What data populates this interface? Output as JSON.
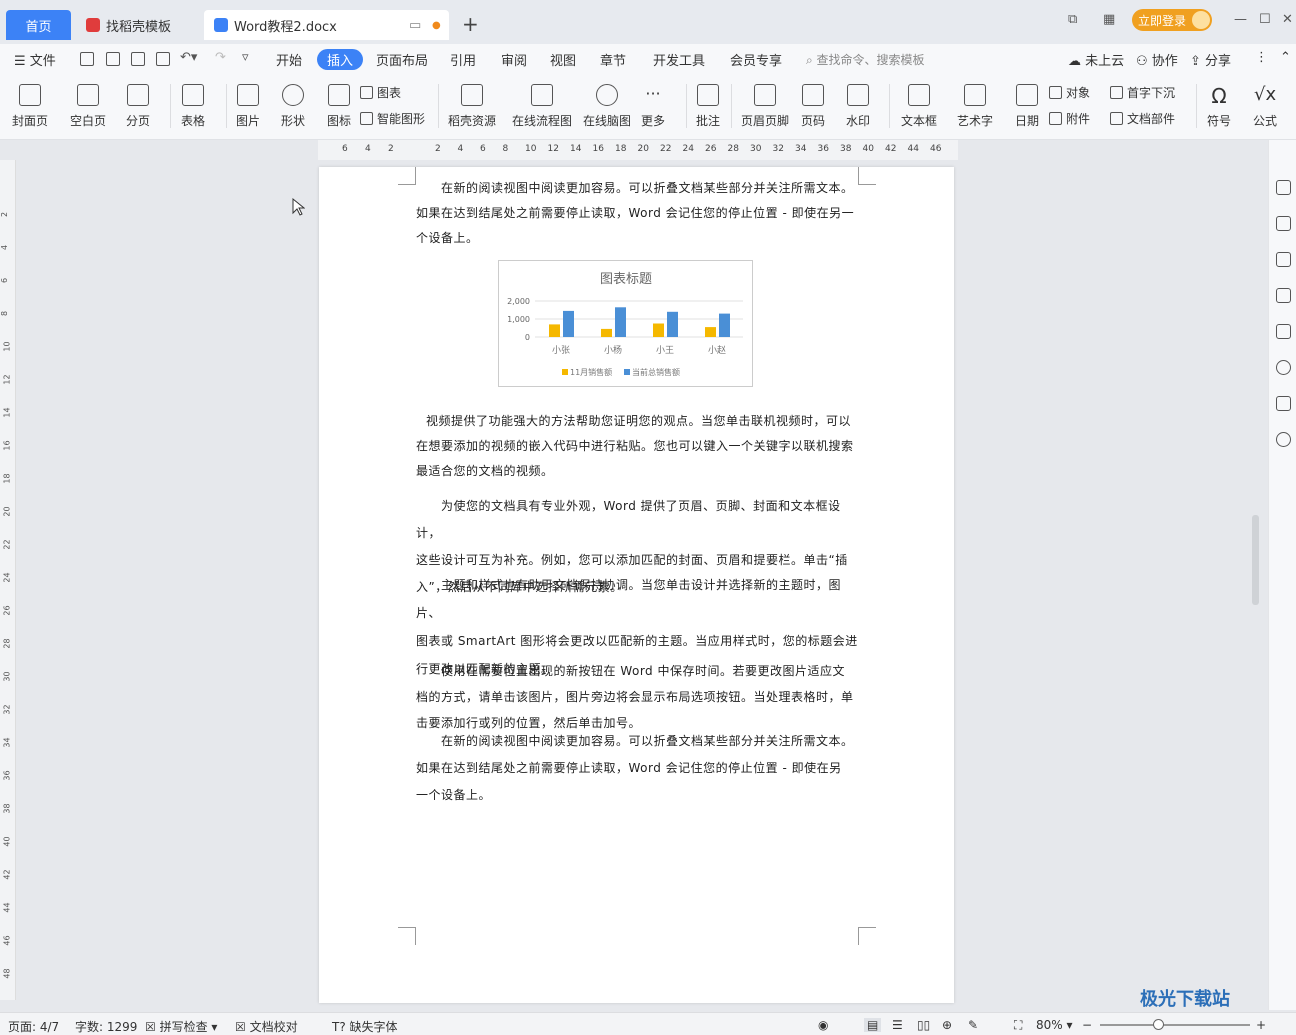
{
  "tabs": {
    "home": "首页",
    "template": "找稻壳模板",
    "doc": "Word教程2.docx"
  },
  "header": {
    "login": "立即登录"
  },
  "menu": {
    "file": "文件",
    "items": [
      "开始",
      "插入",
      "页面布局",
      "引用",
      "审阅",
      "视图",
      "章节",
      "开发工具",
      "会员专享"
    ],
    "active": "插入",
    "search": "查找命令、搜索模板",
    "cloud": "未上云",
    "collab": "协作",
    "share": "分享"
  },
  "ribbon": {
    "cover": "封面页",
    "blank": "空白页",
    "pagebreak": "分页",
    "table": "表格",
    "picture": "图片",
    "shape": "形状",
    "icon": "图标",
    "chart": "图表",
    "smartart": "智能图形",
    "docer": "稻壳资源",
    "flow": "在线流程图",
    "mind": "在线脑图",
    "more": "更多",
    "comment": "批注",
    "headerfooter": "页眉页脚",
    "pagenum": "页码",
    "watermark": "水印",
    "textbox": "文本框",
    "wordart": "艺术字",
    "date": "日期",
    "object": "对象",
    "attach": "附件",
    "dropcap": "首字下沉",
    "docpart": "文档部件",
    "symbol": "符号",
    "formula": "公式"
  },
  "ruler_h": [
    "6",
    "4",
    "2",
    "2",
    "4",
    "6",
    "8",
    "10",
    "12",
    "14",
    "16",
    "18",
    "20",
    "22",
    "24",
    "26",
    "28",
    "30",
    "32",
    "34",
    "36",
    "38",
    "40",
    "42",
    "44",
    "46"
  ],
  "ruler_v": [
    "2",
    "4",
    "6",
    "8",
    "10",
    "12",
    "14",
    "16",
    "18",
    "20",
    "22",
    "24",
    "26",
    "28",
    "30",
    "32",
    "34",
    "36",
    "38",
    "40",
    "42",
    "44",
    "46",
    "48"
  ],
  "paragraphs": [
    [
      "在新的阅读视图中阅读更加容易。可以折叠文档某些部分并关注所需文本。",
      "如果在达到结尾处之前需要停止读取，Word 会记住您的停止位置 - 即使在另一",
      "个设备上。"
    ],
    [
      "视频提供了功能强大的方法帮助您证明您的观点。当您单击联机视频时，可以",
      "在想要添加的视频的嵌入代码中进行粘贴。您也可以键入一个关键字以联机搜索",
      "最适合您的文档的视频。"
    ],
    [
      "为使您的文档具有专业外观，Word 提供了页眉、页脚、封面和文本框设计，",
      "这些设计可互为补充。例如，您可以添加匹配的封面、页眉和提要栏。单击“插",
      "入”，然后从不同库中选择所需元素。"
    ],
    [
      "主题和样式也有助于文档保持协调。当您单击设计并选择新的主题时，图片、",
      "图表或 SmartArt 图形将会更改以匹配新的主题。当应用样式时，您的标题会进",
      "行更改以匹配新的主题。"
    ],
    [
      "使用在需要位置出现的新按钮在 Word 中保存时间。若要更改图片适应文",
      "档的方式，请单击该图片，图片旁边将会显示布局选项按钮。当处理表格时，单",
      "击要添加行或列的位置，然后单击加号。"
    ],
    [
      "在新的阅读视图中阅读更加容易。可以折叠文档某些部分并关注所需文本。",
      "如果在达到结尾处之前需要停止读取，Word 会记住您的停止位置 - 即使在另",
      "一个设备上。"
    ]
  ],
  "chart_data": {
    "type": "bar",
    "title": "图表标题",
    "categories": [
      "小张",
      "小杨",
      "小王",
      "小赵"
    ],
    "series": [
      {
        "name": "11月销售额",
        "color": "#f5b800",
        "values": [
          700,
          450,
          750,
          550
        ]
      },
      {
        "name": "当前总销售额",
        "color": "#4a8fd6",
        "values": [
          1450,
          1650,
          1400,
          1300
        ]
      }
    ],
    "yticks": [
      "2,000",
      "1,000",
      "0"
    ],
    "ylim": [
      0,
      2000
    ]
  },
  "status": {
    "page": "页面: 4/7",
    "words": "字数: 1299",
    "spell": "拼写检查",
    "proof": "文档校对",
    "font": "缺失字体",
    "zoom": "80%"
  },
  "watermark": "极光下载站"
}
